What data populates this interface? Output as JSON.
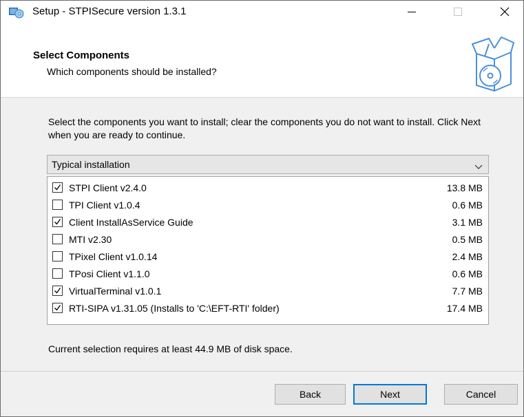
{
  "window": {
    "title": "Setup - STPISecure version 1.3.1",
    "icons": {
      "app": "setup-disc-icon",
      "minimize": "minimize-icon",
      "maximize": "maximize-icon",
      "close": "close-icon"
    }
  },
  "header": {
    "title": "Select Components",
    "subtitle": "Which components should be installed?",
    "icon": "software-box-icon"
  },
  "instructions": "Select the components you want to install; clear the components you do not want to install. Click Next when you are ready to continue.",
  "install_type": {
    "selected": "Typical installation",
    "icon": "chevron-down-icon"
  },
  "components": [
    {
      "label": "STPI Client v2.4.0",
      "size": "13.8 MB",
      "checked": true
    },
    {
      "label": "TPI Client v1.0.4",
      "size": "0.6 MB",
      "checked": false
    },
    {
      "label": "Client InstallAsService Guide",
      "size": "3.1 MB",
      "checked": true
    },
    {
      "label": "MTI v2.30",
      "size": "0.5 MB",
      "checked": false
    },
    {
      "label": "TPixel Client v1.0.14",
      "size": "2.4 MB",
      "checked": false
    },
    {
      "label": "TPosi Client v1.1.0",
      "size": "0.6 MB",
      "checked": false
    },
    {
      "label": "VirtualTerminal v1.0.1",
      "size": "7.7 MB",
      "checked": true
    },
    {
      "label": "RTI-SIPA v1.31.05 (Installs to 'C:\\EFT-RTI' folder)",
      "size": "17.4 MB",
      "checked": true
    }
  ],
  "disk_space": "Current selection requires at least 44.9 MB of disk space.",
  "buttons": {
    "back": "Back",
    "next": "Next",
    "cancel": "Cancel"
  },
  "colors": {
    "accent": "#0078d7",
    "box_icon": "#4a90d9"
  }
}
